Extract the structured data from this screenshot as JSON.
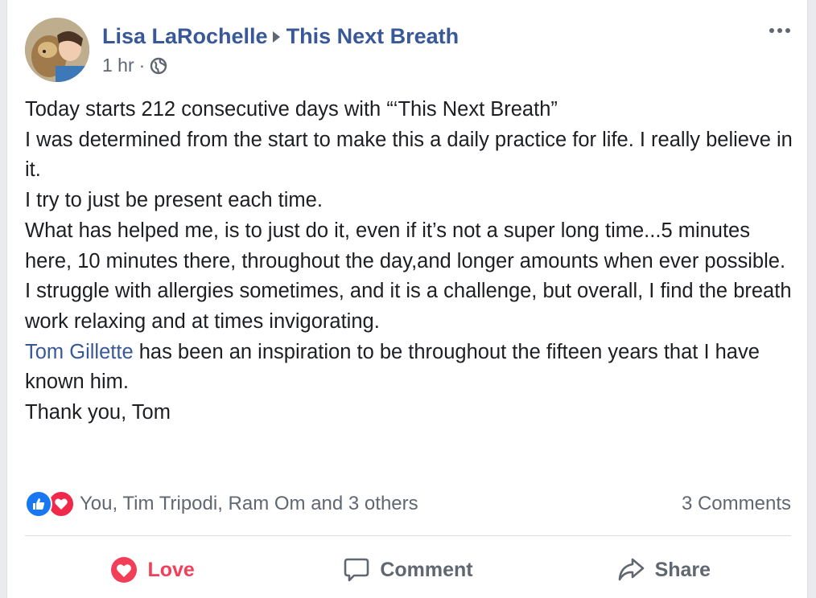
{
  "post": {
    "author": "Lisa LaRochelle",
    "group": "This Next Breath",
    "time": "1 hr",
    "separator": "·",
    "privacy_icon": "globe-icon",
    "body": [
      "Today starts 212 consecutive days with “‘This Next Breath”",
      "I was determined from the start to make this a daily practice for life. I really believe in it.",
      "I try to just be present each time.",
      "What has helped me, is to just do it, even if it’s not a super long time...5 minutes here, 10 minutes there, throughout the day,and longer amounts when ever possible.",
      "I struggle with allergies sometimes, and it is a challenge, but overall, I find the breath work relaxing and at times invigorating."
    ],
    "mention": {
      "name": "Tom Gillette",
      "rest": " has been an inspiration to be throughout the fifteen years that I have known him."
    },
    "closing": "Thank you, Tom"
  },
  "reactions": {
    "icons": [
      "like-icon",
      "love-icon"
    ],
    "names": "You, Tim Tripodi, Ram Om and 3 others",
    "comments": "3 Comments"
  },
  "actions": {
    "love": "Love",
    "comment": "Comment",
    "share": "Share"
  },
  "colors": {
    "link": "#385898",
    "text": "#1c1e21",
    "muted": "#606770",
    "love": "#f33e58",
    "like": "#1877f2"
  }
}
